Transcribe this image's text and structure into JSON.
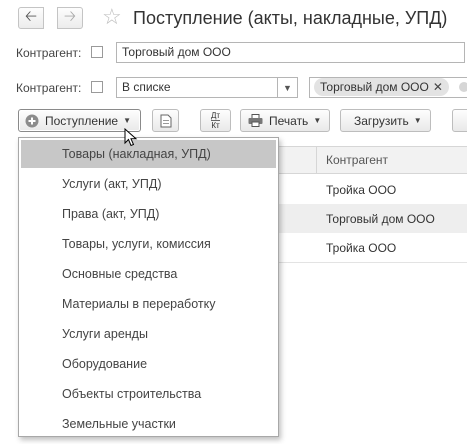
{
  "header": {
    "back_icon": "arrow-left-icon",
    "forward_icon": "arrow-right-icon",
    "favorite_icon": "star-icon",
    "title": "Поступление (акты, накладные, УПД)"
  },
  "filters": {
    "row1": {
      "label": "Контрагент:",
      "value": "Торговый дом ООО"
    },
    "row2": {
      "label": "Контрагент:",
      "condition": "В списке",
      "tag": "Торговый дом ООО"
    }
  },
  "toolbar": {
    "receipt_label": "Поступление",
    "print_label": "Печать",
    "load_label": "Загрузить",
    "dtkt_top": "Дт",
    "dtkt_bottom": "Кт"
  },
  "table": {
    "column_header": "Контрагент",
    "rows": [
      "Тройка ООО",
      "Торговый дом ООО",
      "Тройка ООО"
    ]
  },
  "menu": {
    "items": [
      "Товары (накладная, УПД)",
      "Услуги (акт, УПД)",
      "Права (акт, УПД)",
      "Товары, услуги, комиссия",
      "Основные средства",
      "Материалы в переработку",
      "Услуги аренды",
      "Оборудование",
      "Объекты строительства",
      "Земельные участки"
    ],
    "selected_index": 0
  },
  "colors": {
    "menu_selected": "#c7c7c7",
    "tag_bg": "#e3e3e3"
  }
}
